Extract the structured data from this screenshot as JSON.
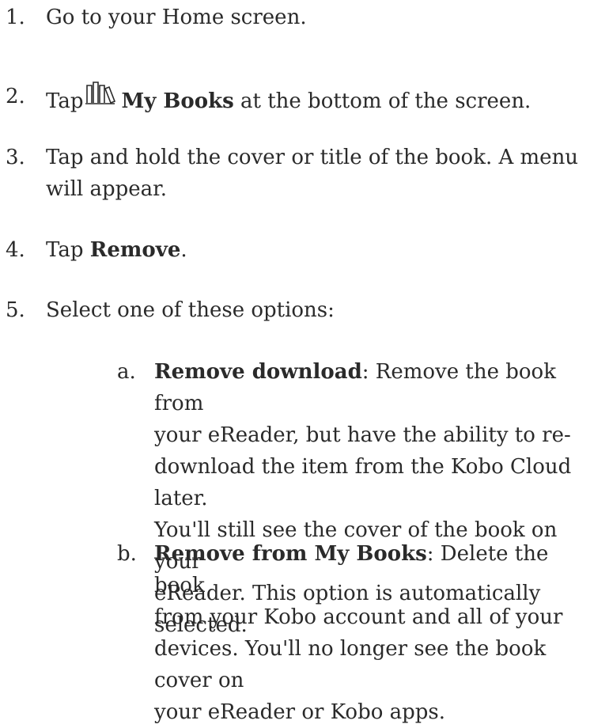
{
  "steps": [
    {
      "number": "1.",
      "text": "Go to your Home screen."
    },
    {
      "number": "2.",
      "before": "Tap",
      "bold": "My Books",
      "after": " at the bottom of the screen.",
      "icon": "my-books-icon"
    },
    {
      "number": "3.",
      "text_line1": "Tap and hold the cover or title of the book. A menu",
      "text_line2": "will appear."
    },
    {
      "number": "4.",
      "before": "Tap ",
      "bold": "Remove",
      "after": "."
    },
    {
      "number": "5.",
      "text": "Select one of these options:"
    }
  ],
  "options": [
    {
      "letter": "a.",
      "bold": "Remove download",
      "lines": [
        ": Remove the book from",
        "your eReader, but have the ability to re-",
        "download the item from the Kobo Cloud later.",
        "You'll still see the cover of the book on your",
        "eReader. This option is automatically selected."
      ]
    },
    {
      "letter": "b.",
      "bold": "Remove from My Books",
      "lines": [
        ": Delete the book",
        "from your Kobo account and all of your",
        "devices. You'll no longer see the book cover on",
        "your eReader or Kobo apps."
      ]
    }
  ]
}
